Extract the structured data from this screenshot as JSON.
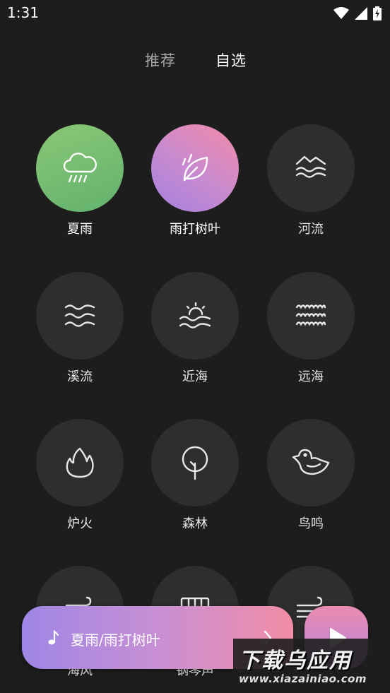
{
  "status": {
    "time": "1:31"
  },
  "tabs": [
    {
      "label": "推荐",
      "selected": false
    },
    {
      "label": "自选",
      "selected": true
    }
  ],
  "sounds": [
    {
      "label": "夏雨",
      "icon": "rain-cloud-icon",
      "active": true,
      "color": "#74bd70"
    },
    {
      "label": "雨打树叶",
      "icon": "leaf-rain-icon",
      "active": true,
      "color": "#d98ac0"
    },
    {
      "label": "河流",
      "icon": "river-icon",
      "active": false
    },
    {
      "label": "溪流",
      "icon": "stream-icon",
      "active": false
    },
    {
      "label": "近海",
      "icon": "sunrise-sea-icon",
      "active": false
    },
    {
      "label": "远海",
      "icon": "ocean-waves-icon",
      "active": false
    },
    {
      "label": "炉火",
      "icon": "flame-icon",
      "active": false
    },
    {
      "label": "森林",
      "icon": "tree-icon",
      "active": false
    },
    {
      "label": "鸟鸣",
      "icon": "bird-icon",
      "active": false
    },
    {
      "label": "海风",
      "icon": "wind-icon",
      "active": false
    },
    {
      "label": "钢琴声",
      "icon": "piano-icon",
      "active": false
    },
    {
      "label": "",
      "icon": "wind-icon",
      "active": false
    }
  ],
  "player": {
    "title": "夏雨/雨打树叶"
  },
  "watermark": {
    "line1": "下载乌应用",
    "line2": "www.xiazainiao.com"
  }
}
